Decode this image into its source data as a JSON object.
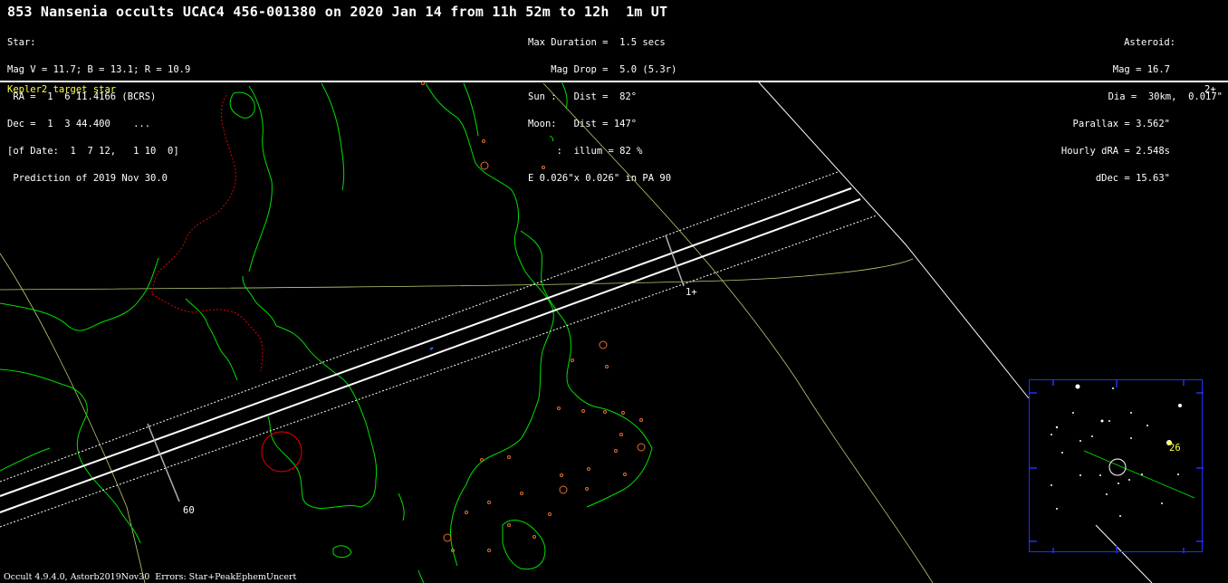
{
  "title": "853 Nansenia occults UCAC4 456-001380 on 2020 Jan 14 from 11h 52m to 12h  1m UT",
  "star_block": [
    "Star:",
    "Mag V = 11.7; B = 13.1; R = 10.9",
    " RA =  1  6 11.4166 (BCRS)",
    "Dec =  1  3 44.400    ...",
    "[of Date:  1  7 12,   1 10  0]",
    " Prediction of 2019 Nov 30.0"
  ],
  "event_block": [
    "Max Duration =  1.5 secs",
    "    Mag Drop =  5.0 (5.3r)",
    "Sun :   Dist =  82°",
    "Moon:   Dist = 147°",
    "     :  illum = 82 %",
    "E 0.026\"x 0.026\" in PA 90"
  ],
  "asteroid_block": [
    "Asteroid:",
    "Mag = 16.7",
    "Dia =  30km,  0.017\"",
    "Parallax = 3.562\"",
    "Hourly dRA = 2.548s",
    "dDec = 15.63\""
  ],
  "kepler_label": "Kepler2 target star",
  "corner_tag": "2+",
  "track_label_1": "1+",
  "track_label_60": "60",
  "inset_label": "26",
  "footer": "Occult 4.9.4.0, Astorb2019Nov30  Errors: Star+PeakEphemUncert",
  "colors": {
    "background": "#000000",
    "coastline": "#00e000",
    "border": "#e00000",
    "path_center": "#ffffff",
    "graticule": "#b8d070",
    "cities": "#e07030",
    "kepler": "#ffff40",
    "inset_frame": "#2030ff"
  }
}
